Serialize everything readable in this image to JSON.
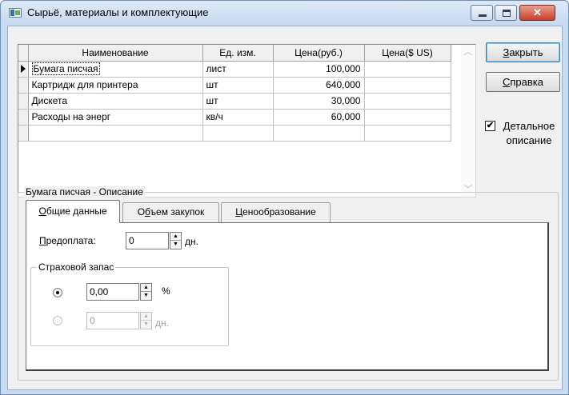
{
  "window": {
    "title": "Сырьё, материалы и комплектующие",
    "minimize_glyph": "",
    "close_glyph": "✕"
  },
  "grid": {
    "columns": [
      "Наименование",
      "Ед. изм.",
      "Цена(руб.)",
      "Цена($ US)"
    ],
    "rows": [
      [
        "Бумага писчая",
        "лист",
        "100,000",
        ""
      ],
      [
        "Картридж для принтера",
        "шт",
        "640,000",
        ""
      ],
      [
        "Дискета",
        "шт",
        "30,000",
        ""
      ],
      [
        "Расходы на энерг",
        "кв/ч",
        "60,000",
        ""
      ]
    ],
    "scroll_up": "︿",
    "scroll_down": "﹀"
  },
  "buttons": {
    "close_hot": "З",
    "close_rest": "акрыть",
    "help_hot": "С",
    "help_rest": "правка"
  },
  "detail_checkbox": {
    "checked": true,
    "mark": "✔",
    "label_hot": "Д",
    "label_rest": "етальное",
    "label_line2": "описание"
  },
  "description_group": {
    "title": "Бумага писчая - Описание",
    "tabs": [
      {
        "pre": "",
        "hot": "О",
        "post": "бщие данные"
      },
      {
        "pre": "О",
        "hot": "б",
        "post": "ъем закупок"
      },
      {
        "pre": "",
        "hot": "Ц",
        "post": "енообразование"
      }
    ],
    "prepayment": {
      "label_hot": "П",
      "label_rest": "редоплата:",
      "value": "0",
      "unit": "дн."
    },
    "safety_stock": {
      "title": "Страховой запас",
      "percent_value": "0,00",
      "percent_unit": "%",
      "days_value": "0",
      "days_unit": "дн.",
      "selected": "percent"
    },
    "spin_up": "▲",
    "spin_down": "▼"
  }
}
